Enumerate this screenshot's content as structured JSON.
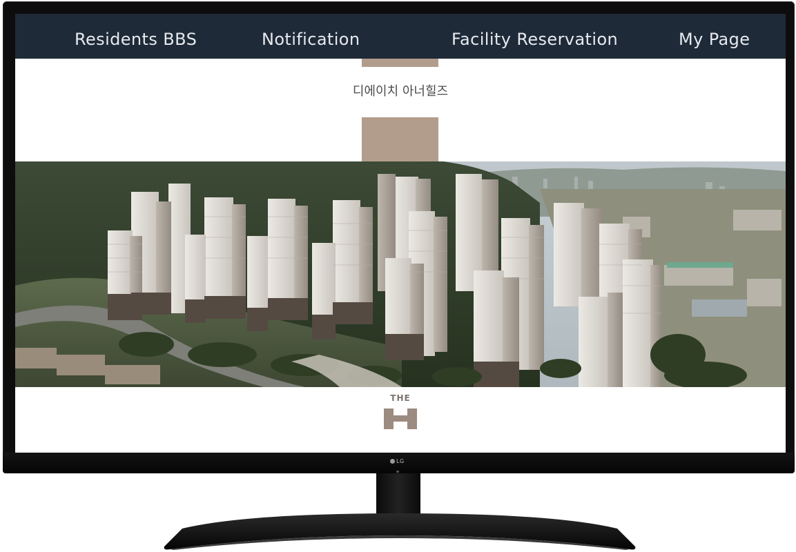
{
  "nav": {
    "items": [
      {
        "label": "Residents BBS"
      },
      {
        "label": "Notification"
      },
      {
        "label": "Facility Reservation"
      },
      {
        "label": "My Page"
      }
    ]
  },
  "header": {
    "complex_name": "디에이치 아너힐즈"
  },
  "logo": {
    "top_text": "THE",
    "letter": "H"
  },
  "monitor": {
    "brand": "LG"
  },
  "colors": {
    "nav_bg": "#1f2a38",
    "nav_text": "#e6eaef",
    "accent_tan": "#b29d8d",
    "logo_mark": "#9c8b80"
  },
  "icons": {
    "brand_logo": "lg-logo-icon",
    "hero": "apartment-complex-aerial-image",
    "logo_mark": "the-h-logo-icon"
  }
}
